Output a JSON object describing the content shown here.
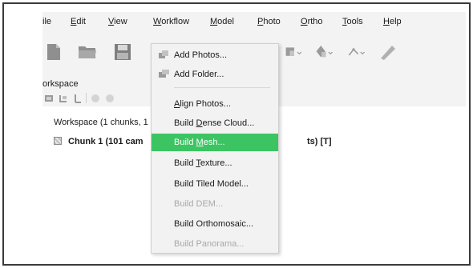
{
  "menubar": {
    "items": [
      {
        "pre": "",
        "ul": "F",
        "post": "ile",
        "visible": "ile"
      },
      {
        "pre": "",
        "ul": "E",
        "post": "dit"
      },
      {
        "pre": "",
        "ul": "V",
        "post": "iew"
      },
      {
        "pre": "",
        "ul": "W",
        "post": "orkflow"
      },
      {
        "pre": "",
        "ul": "M",
        "post": "odel"
      },
      {
        "pre": "",
        "ul": "P",
        "post": "hoto"
      },
      {
        "pre": "",
        "ul": "O",
        "post": "rtho"
      },
      {
        "pre": "",
        "ul": "T",
        "post": "ools"
      },
      {
        "pre": "",
        "ul": "H",
        "post": "elp"
      }
    ]
  },
  "workspace": {
    "title": "orkspace",
    "line1": "Workspace (1 chunks, 1",
    "chunk_label": "Chunk 1 (101 cam",
    "chunk_tail": "ts) [T]"
  },
  "workflow_menu": {
    "items": [
      {
        "pre": "Add Photos...",
        "ul": "",
        "post": "",
        "enabled": true,
        "icon": "add-photos-icon"
      },
      {
        "pre": "Add Folder...",
        "ul": "",
        "post": "",
        "enabled": true,
        "icon": "add-folder-icon"
      },
      {
        "pre": "",
        "ul": "A",
        "post": "lign Photos...",
        "enabled": true
      },
      {
        "pre": "Build ",
        "ul": "D",
        "post": "ense Cloud...",
        "enabled": true
      },
      {
        "pre": "Build ",
        "ul": "M",
        "post": "esh...",
        "enabled": true,
        "highlighted": true
      },
      {
        "pre": "Build ",
        "ul": "T",
        "post": "exture...",
        "enabled": true
      },
      {
        "pre": "Build Tiled Model...",
        "ul": "",
        "post": "",
        "enabled": true
      },
      {
        "pre": "Build DEM...",
        "ul": "",
        "post": "",
        "enabled": false
      },
      {
        "pre": "Build Orthomosaic...",
        "ul": "",
        "post": "",
        "enabled": true
      },
      {
        "pre": "Build Panorama...",
        "ul": "",
        "post": "",
        "enabled": false
      }
    ]
  },
  "colors": {
    "highlight": "#3cc463",
    "disabled_text": "#a8a8a8",
    "menu_bg": "#f2f2f2"
  }
}
